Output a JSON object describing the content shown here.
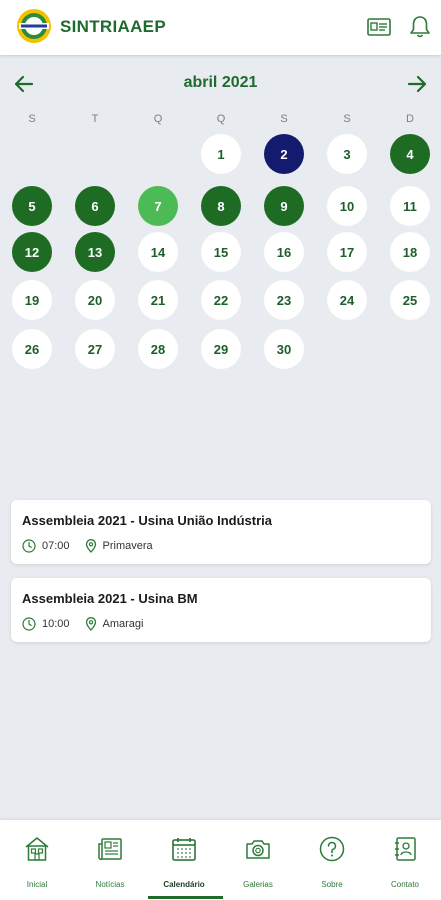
{
  "header": {
    "brand": "SINTRIAAEP",
    "logo_text": "SINTRIAAEP",
    "icons": [
      "id-card-icon",
      "bell-icon"
    ]
  },
  "calendar": {
    "month_label": "abril 2021",
    "weekdays": [
      "S",
      "T",
      "Q",
      "Q",
      "S",
      "S",
      "D"
    ],
    "days": [
      {
        "n": "1",
        "state": "normal"
      },
      {
        "n": "2",
        "state": "selected"
      },
      {
        "n": "3",
        "state": "normal"
      },
      {
        "n": "4",
        "state": "event"
      },
      {
        "n": "5",
        "state": "event"
      },
      {
        "n": "6",
        "state": "event"
      },
      {
        "n": "7",
        "state": "today"
      },
      {
        "n": "8",
        "state": "event"
      },
      {
        "n": "9",
        "state": "event"
      },
      {
        "n": "10",
        "state": "normal"
      },
      {
        "n": "11",
        "state": "normal"
      },
      {
        "n": "12",
        "state": "event"
      },
      {
        "n": "13",
        "state": "event"
      },
      {
        "n": "14",
        "state": "normal"
      },
      {
        "n": "15",
        "state": "normal"
      },
      {
        "n": "16",
        "state": "normal"
      },
      {
        "n": "17",
        "state": "normal"
      },
      {
        "n": "18",
        "state": "normal"
      },
      {
        "n": "19",
        "state": "normal"
      },
      {
        "n": "20",
        "state": "normal"
      },
      {
        "n": "21",
        "state": "normal"
      },
      {
        "n": "22",
        "state": "normal"
      },
      {
        "n": "23",
        "state": "normal"
      },
      {
        "n": "24",
        "state": "normal"
      },
      {
        "n": "25",
        "state": "normal"
      },
      {
        "n": "26",
        "state": "normal"
      },
      {
        "n": "27",
        "state": "normal"
      },
      {
        "n": "28",
        "state": "normal"
      },
      {
        "n": "29",
        "state": "normal"
      },
      {
        "n": "30",
        "state": "normal"
      }
    ]
  },
  "events": [
    {
      "title": "Assembleia 2021 - Usina União Indústria",
      "time": "07:00",
      "location": "Primavera"
    },
    {
      "title": "Assembleia 2021 - Usina BM",
      "time": "10:00",
      "location": "Amaragi"
    }
  ],
  "bottom_nav": [
    {
      "label": "Inicial",
      "icon": "home-icon"
    },
    {
      "label": "Notícias",
      "icon": "newspaper-icon"
    },
    {
      "label": "Calendário",
      "icon": "calendar-icon",
      "active": true
    },
    {
      "label": "Galerias",
      "icon": "camera-icon"
    },
    {
      "label": "Sobre",
      "icon": "help-icon"
    },
    {
      "label": "Contato",
      "icon": "contact-book-icon"
    }
  ],
  "colors": {
    "brand_green": "#1f6b2e",
    "event_green": "#1e6b24",
    "today_green": "#4cbb56",
    "selected_navy": "#131b6e",
    "background": "#e8ebef"
  }
}
